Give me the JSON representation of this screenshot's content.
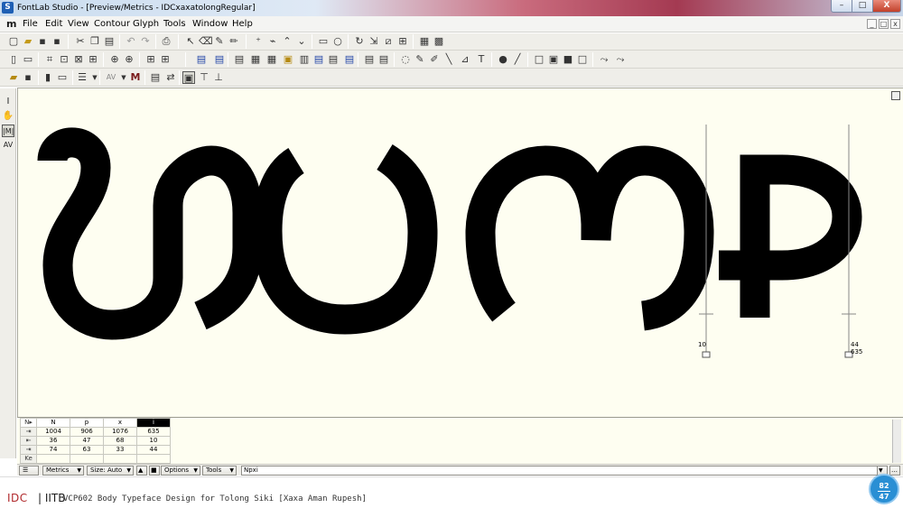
{
  "window": {
    "app_icon": "S",
    "title": "FontLab Studio - [Preview/Metrics - IDCxaxatolongRegular]",
    "min": "–",
    "max": "□",
    "close": "X"
  },
  "menubar": {
    "logo": "m",
    "items": [
      "File",
      "Edit",
      "View",
      "Contour",
      "Glyph",
      "Tools",
      "Window",
      "Help"
    ],
    "mdi_controls": [
      "_",
      "□",
      "x"
    ]
  },
  "canvas": {
    "metric_labels": {
      "left_lsb": "10",
      "right_lsb": "44",
      "right_width": "635"
    }
  },
  "metrics": {
    "columns": [
      "N",
      "p",
      "x",
      "i"
    ],
    "selected_column": "i",
    "corner": "N▸",
    "rows": [
      {
        "icon": "⇥",
        "values": [
          "1004",
          "906",
          "1076",
          "635"
        ]
      },
      {
        "icon": "⇤",
        "values": [
          "36",
          "47",
          "68",
          "10"
        ]
      },
      {
        "icon": "⇥",
        "values": [
          "74",
          "63",
          "33",
          "44"
        ]
      },
      {
        "icon": "Ke",
        "values": [
          "",
          "",
          "",
          ""
        ]
      }
    ]
  },
  "bottombar": {
    "metrics_label": "Metrics",
    "size_label": "Size: Auto",
    "options_label": "Options",
    "tools_label": "Tools",
    "text_value": "Npxi"
  },
  "footer": {
    "idc": "IDC",
    "iitb": "| IITB",
    "course": "VCP602 Body Typeface Design for Tolong Siki [Xaxa Aman Rupesh]",
    "page_current": "82",
    "page_total": "47"
  }
}
